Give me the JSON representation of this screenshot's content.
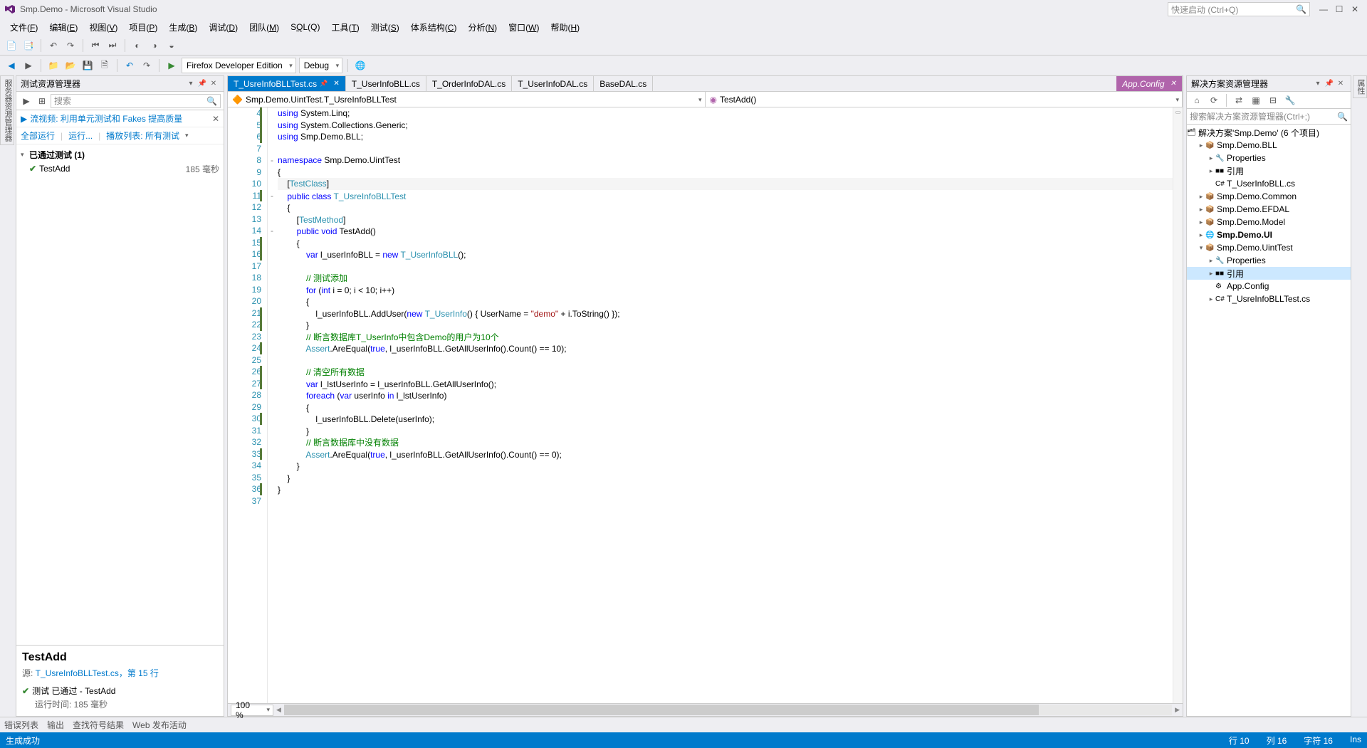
{
  "titlebar": {
    "title": "Smp.Demo - Microsoft Visual Studio",
    "quicklaunch_placeholder": "快速启动 (Ctrl+Q)"
  },
  "menubar": [
    {
      "label": "文件(F)",
      "key": "F"
    },
    {
      "label": "编辑(E)",
      "key": "E"
    },
    {
      "label": "视图(V)",
      "key": "V"
    },
    {
      "label": "项目(P)",
      "key": "P"
    },
    {
      "label": "生成(B)",
      "key": "B"
    },
    {
      "label": "调试(D)",
      "key": "D"
    },
    {
      "label": "团队(M)",
      "key": "M"
    },
    {
      "label": "SQL(Q)",
      "key": "Q"
    },
    {
      "label": "工具(T)",
      "key": "T"
    },
    {
      "label": "测试(S)",
      "key": "S"
    },
    {
      "label": "体系结构(C)",
      "key": "C"
    },
    {
      "label": "分析(N)",
      "key": "N"
    },
    {
      "label": "窗口(W)",
      "key": "W"
    },
    {
      "label": "帮助(H)",
      "key": "H"
    }
  ],
  "toolbar2": {
    "run_target": "Firefox Developer Edition",
    "config": "Debug"
  },
  "test_explorer": {
    "title": "测试资源管理器",
    "search_placeholder": "搜索",
    "stream_link": "流视频: 利用单元测试和 Fakes 提高质量",
    "filter_all": "全部运行",
    "filter_run": "运行...",
    "filter_playlist": "播放列表: 所有测试",
    "group_label": "已通过测试 (1)",
    "test_name": "TestAdd",
    "test_time": "185 毫秒",
    "detail_name": "TestAdd",
    "detail_src_prefix": "源: ",
    "detail_src_link": "T_UsreInfoBLLTest.cs，第 15 行",
    "detail_status": "测试 已通过 - TestAdd",
    "detail_runtime": "运行时间: 185 毫秒"
  },
  "tabs": [
    {
      "label": "T_UsreInfoBLLTest.cs",
      "active": true,
      "pinned": true
    },
    {
      "label": "T_UserInfoBLL.cs"
    },
    {
      "label": "T_OrderInfoDAL.cs"
    },
    {
      "label": "T_UserInfoDAL.cs"
    },
    {
      "label": "BaseDAL.cs"
    },
    {
      "label": "App.Config",
      "preview": true
    }
  ],
  "navbar": {
    "left": "Smp.Demo.UintTest.T_UsreInfoBLLTest",
    "right": "TestAdd()"
  },
  "code_lines": [
    {
      "n": 4,
      "green": true,
      "html": "<span class='kw'>using</span> System.Linq;"
    },
    {
      "n": 5,
      "green": true,
      "html": "<span class='kw'>using</span> System.Collections.Generic;"
    },
    {
      "n": 6,
      "green": true,
      "html": "<span class='kw'>using</span> Smp.Demo.BLL;"
    },
    {
      "n": 7,
      "html": ""
    },
    {
      "n": 8,
      "fold": "-",
      "html": "<span class='kw'>namespace</span> Smp.Demo.UintTest"
    },
    {
      "n": 9,
      "html": "{"
    },
    {
      "n": 10,
      "hl": true,
      "html": "    [<span class='type'>TestClass</span>]"
    },
    {
      "n": 11,
      "green": true,
      "fold": "-",
      "html": "    <span class='kw'>public</span> <span class='kw'>class</span> <span class='type'>T_UsreInfoBLLTest</span>"
    },
    {
      "n": 12,
      "html": "    {"
    },
    {
      "n": 13,
      "html": "        [<span class='type'>TestMethod</span>]"
    },
    {
      "n": 14,
      "fold": "-",
      "html": "        <span class='kw'>public</span> <span class='kw'>void</span> TestAdd()"
    },
    {
      "n": 15,
      "green": true,
      "html": "        {"
    },
    {
      "n": 16,
      "green": true,
      "html": "            <span class='kw'>var</span> l_userInfoBLL = <span class='kw'>new</span> <span class='type'>T_UserInfoBLL</span>();"
    },
    {
      "n": 17,
      "html": ""
    },
    {
      "n": 18,
      "html": "            <span class='cmt'>// 测试添加</span>"
    },
    {
      "n": 19,
      "html": "            <span class='kw'>for</span> (<span class='kw'>int</span> i = 0; i &lt; 10; i++)"
    },
    {
      "n": 20,
      "html": "            {"
    },
    {
      "n": 21,
      "green": true,
      "html": "                l_userInfoBLL.AddUser(<span class='kw'>new</span> <span class='type'>T_UserInfo</span>() { UserName = <span class='str'>\"demo\"</span> + i.ToString() });"
    },
    {
      "n": 22,
      "green": true,
      "html": "            }"
    },
    {
      "n": 23,
      "html": "            <span class='cmt'>// 断言数据库T_UserInfo中包含Demo的用户为10个</span>"
    },
    {
      "n": 24,
      "green": true,
      "html": "            <span class='type'>Assert</span>.AreEqual(<span class='kw'>true</span>, l_userInfoBLL.GetAllUserInfo().Count() == 10);"
    },
    {
      "n": 25,
      "html": ""
    },
    {
      "n": 26,
      "green": true,
      "html": "            <span class='cmt'>// 清空所有数据</span>"
    },
    {
      "n": 27,
      "green": true,
      "html": "            <span class='kw'>var</span> l_lstUserInfo = l_userInfoBLL.GetAllUserInfo();"
    },
    {
      "n": 28,
      "html": "            <span class='kw'>foreach</span> (<span class='kw'>var</span> userInfo <span class='kw'>in</span> l_lstUserInfo)"
    },
    {
      "n": 29,
      "html": "            {"
    },
    {
      "n": 30,
      "green": true,
      "html": "                l_userInfoBLL.Delete(userInfo);"
    },
    {
      "n": 31,
      "html": "            }"
    },
    {
      "n": 32,
      "html": "            <span class='cmt'>// 断言数据库中没有数据</span>"
    },
    {
      "n": 33,
      "green": true,
      "html": "            <span class='type'>Assert</span>.AreEqual(<span class='kw'>true</span>, l_userInfoBLL.GetAllUserInfo().Count() == 0);"
    },
    {
      "n": 34,
      "html": "        }"
    },
    {
      "n": 35,
      "html": "    }"
    },
    {
      "n": 36,
      "green": true,
      "html": "}"
    },
    {
      "n": 37,
      "html": ""
    }
  ],
  "zoom": "100 %",
  "solution": {
    "title": "解决方案资源管理器",
    "search_placeholder": "搜索解决方案资源管理器(Ctrl+;)",
    "root": "解决方案'Smp.Demo' (6 个项目)",
    "tree": [
      {
        "indent": 1,
        "exp": "▸",
        "icon": "📦",
        "label": "Smp.Demo.BLL",
        "open": true,
        "children": [
          {
            "indent": 2,
            "exp": "▸",
            "icon": "🔧",
            "label": "Properties"
          },
          {
            "indent": 2,
            "exp": "▸",
            "icon": "■■",
            "label": "引用"
          },
          {
            "indent": 2,
            "exp": "",
            "icon": "C#",
            "label": "T_UserInfoBLL.cs"
          }
        ]
      },
      {
        "indent": 1,
        "exp": "▸",
        "icon": "📦",
        "label": "Smp.Demo.Common"
      },
      {
        "indent": 1,
        "exp": "▸",
        "icon": "📦",
        "label": "Smp.Demo.EFDAL"
      },
      {
        "indent": 1,
        "exp": "▸",
        "icon": "📦",
        "label": "Smp.Demo.Model"
      },
      {
        "indent": 1,
        "exp": "▸",
        "icon": "🌐",
        "label": "Smp.Demo.UI",
        "bold": true
      },
      {
        "indent": 1,
        "exp": "▾",
        "icon": "📦",
        "label": "Smp.Demo.UintTest",
        "children": [
          {
            "indent": 2,
            "exp": "▸",
            "icon": "🔧",
            "label": "Properties"
          },
          {
            "indent": 2,
            "exp": "▸",
            "icon": "■■",
            "label": "引用",
            "selected": true
          },
          {
            "indent": 2,
            "exp": "",
            "icon": "⚙",
            "label": "App.Config"
          },
          {
            "indent": 2,
            "exp": "▸",
            "icon": "C#",
            "label": "T_UsreInfoBLLTest.cs"
          }
        ]
      }
    ]
  },
  "bottom_tabs": [
    "错误列表",
    "输出",
    "查找符号结果",
    "Web 发布活动"
  ],
  "statusbar": {
    "left": "生成成功",
    "line": "行 10",
    "col": "列 16",
    "char": "字符 16",
    "ins": "Ins"
  },
  "dock_left": "服务器资源管理器",
  "dock_right": "属性"
}
